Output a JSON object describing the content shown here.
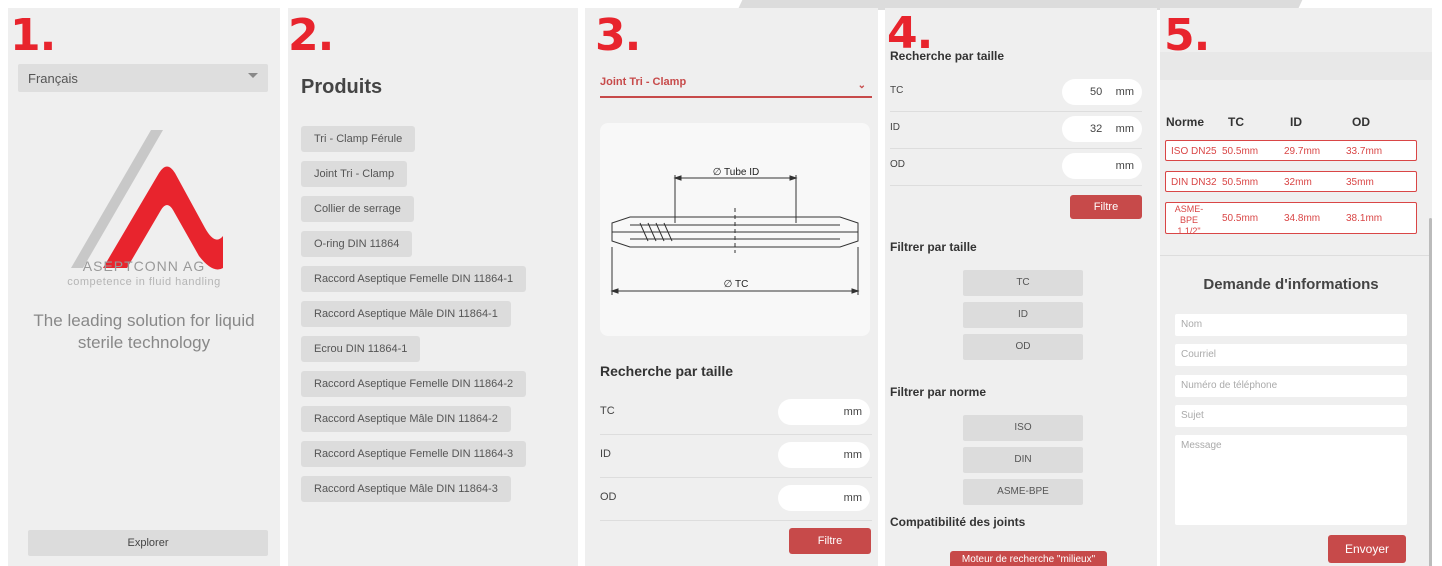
{
  "steps": [
    "1.",
    "2.",
    "3.",
    "4.",
    "5."
  ],
  "panel1": {
    "language": "Français",
    "brand": "ASEPTCONN AG",
    "brand_tagline": "competence in fluid handling",
    "tagline": "The leading solution for liquid sterile technology",
    "explore_button": "Explorer"
  },
  "panel2": {
    "title": "Produits",
    "products": [
      "Tri - Clamp Férule",
      "Joint Tri - Clamp",
      "Collier de serrage",
      "O-ring DIN 11864",
      "Raccord Aseptique Femelle DIN 11864-1",
      "Raccord Aseptique Mâle DIN 11864-1",
      "Ecrou DIN 11864-1",
      "Raccord Aseptique Femelle DIN 11864-2",
      "Raccord Aseptique Mâle DIN 11864-2",
      "Raccord Aseptique Femelle DIN 11864-3",
      "Raccord Aseptique Mâle DIN 11864-3"
    ]
  },
  "panel3": {
    "selected_product": "Joint Tri - Clamp",
    "diagram_labels": {
      "tube_id": "∅ Tube ID",
      "tc": "∅ TC"
    },
    "search_title": "Recherche par taille",
    "rows": [
      {
        "label": "TC",
        "unit": "mm"
      },
      {
        "label": "ID",
        "unit": "mm"
      },
      {
        "label": "OD",
        "unit": "mm"
      }
    ],
    "filter_button": "Filtre"
  },
  "panel4": {
    "search_title": "Recherche par taille",
    "rows": [
      {
        "label": "TC",
        "value": "50",
        "unit": "mm"
      },
      {
        "label": "ID",
        "value": "32",
        "unit": "mm"
      },
      {
        "label": "OD",
        "value": "",
        "unit": "mm"
      }
    ],
    "filter_button": "Filtre",
    "filter_size_title": "Filtrer par taille",
    "size_filters": [
      "TC",
      "ID",
      "OD"
    ],
    "filter_norm_title": "Filtrer par norme",
    "norm_filters": [
      "ISO",
      "DIN",
      "ASME-BPE"
    ],
    "compat_title": "Compatibilité des joints",
    "engine_button": "Moteur de recherche \"milieux\""
  },
  "panel5": {
    "columns": [
      "Norme",
      "TC",
      "ID",
      "OD"
    ],
    "results": [
      {
        "norme": "ISO DN25",
        "tc": "50.5mm",
        "id": "29.7mm",
        "od": "33.7mm"
      },
      {
        "norme": "DIN DN32",
        "tc": "50.5mm",
        "id": "32mm",
        "od": "35mm"
      },
      {
        "norme_line1": "ASME-BPE",
        "norme_line2": "1 1/2\"",
        "tc": "50.5mm",
        "id": "34.8mm",
        "od": "38.1mm"
      }
    ],
    "form_title": "Demande d'informations",
    "placeholders": {
      "name": "Nom",
      "email": "Courriel",
      "phone": "Numéro de téléphone",
      "subject": "Sujet",
      "message": "Message"
    },
    "send_button": "Envoyer"
  },
  "colors": {
    "accent": "#e8242d",
    "button_red": "#c74a4a",
    "panel_bg": "#efefef"
  }
}
